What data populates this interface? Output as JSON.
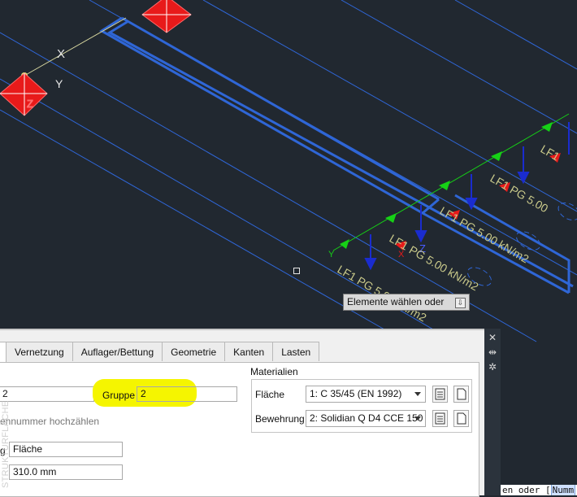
{
  "viewport": {
    "axis_labels": {
      "x": "X",
      "y": "Y",
      "z": "Z"
    },
    "load_labels": [
      {
        "text": "LF1 PG 5.00 kN/m2"
      },
      {
        "text": "LF1 PG 5.00 kN/m2"
      },
      {
        "text": "LF1 PG 5.00 kN/m2"
      },
      {
        "text": "LF1 PG 5.00"
      },
      {
        "text": "LF1"
      }
    ],
    "local_axis_label": "Y",
    "local_axis_z": "Z",
    "local_axis_x": "X",
    "tooltip": "Elemente wählen oder",
    "colors": {
      "background": "#212830",
      "member": "#2f66d6",
      "load_arrow": "#1a2ccf",
      "support": "#e81a1a",
      "axis_y": "#16d116",
      "label": "#c9c98a"
    }
  },
  "palette": {
    "tabs": [
      {
        "label": ""
      },
      {
        "label": "Vernetzung"
      },
      {
        "label": "Auflager/Bettung"
      },
      {
        "label": "Geometrie"
      },
      {
        "label": "Kanten"
      },
      {
        "label": "Lasten"
      }
    ],
    "number_value": "2",
    "gruppe_label": "Gruppe",
    "gruppe_value": "2",
    "increment_label": "ennummer hochzählen",
    "type_label": "g",
    "type_value": "Fläche",
    "thickness_value": "310.0 mm",
    "materials": {
      "title": "Materialien",
      "flaeche_label": "Fläche",
      "flaeche_value": "1: C 35/45 (EN 1992)",
      "bewehrung_label": "Bewehrung",
      "bewehrung_value": "2: Solidian Q D4 CCE 150"
    }
  },
  "strip": {
    "title": "STRUKTURFLÄCHE",
    "close_icon": "close-icon",
    "pin_icon": "pin-icon",
    "settings_icon": "gear-icon"
  },
  "cmdline": {
    "prefix": "en oder [",
    "highlight": "Numm"
  }
}
